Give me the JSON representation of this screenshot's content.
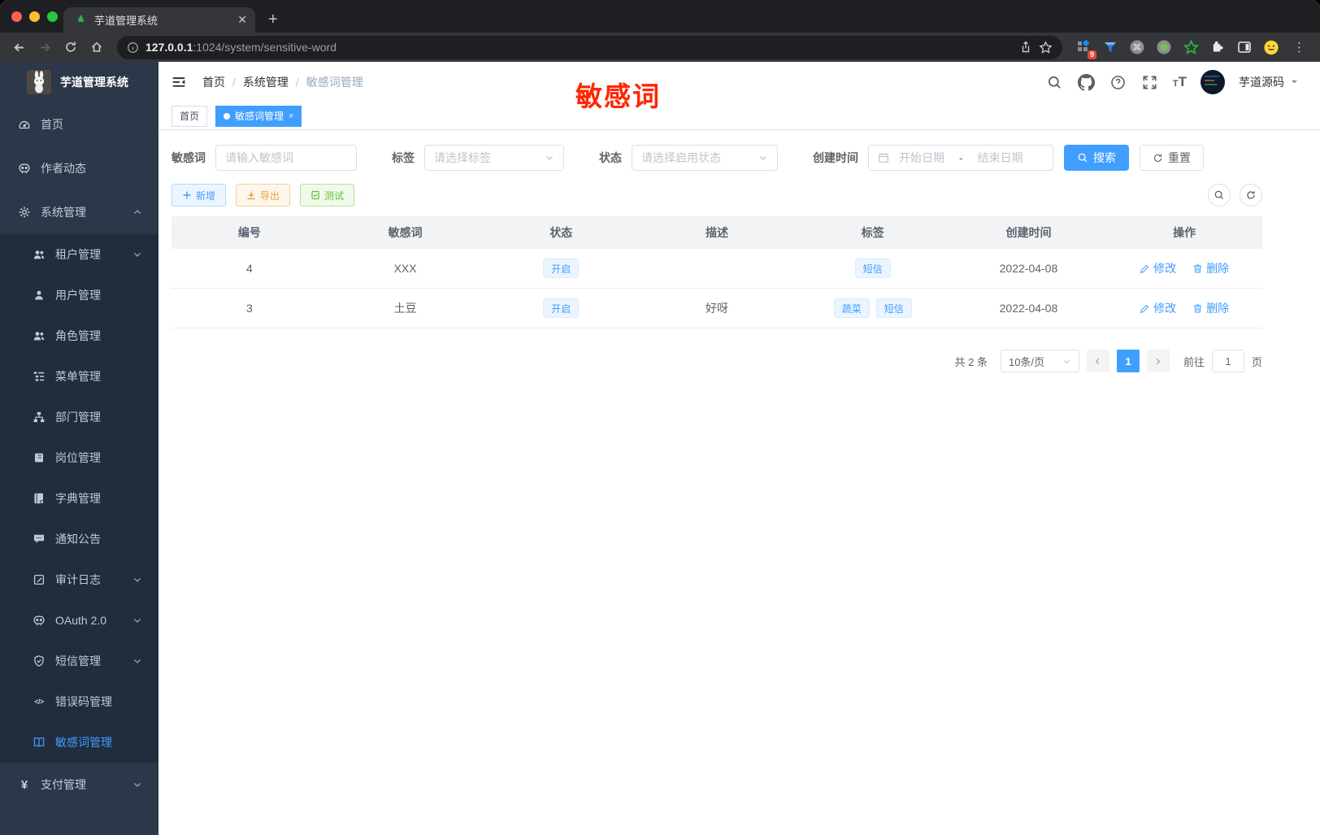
{
  "colors": {
    "primary": "#409eff",
    "warning": "#e6a23c",
    "success": "#67c23a",
    "annotation": "#ff2600",
    "sidebar_bg": "#2c3849",
    "submenu_bg": "#212c3c",
    "sidebar_text": "#bfcbd9",
    "tag_bg": "#ecf5ff",
    "tag_border": "#d9ecff",
    "thead_bg": "#f2f3f5"
  },
  "browser": {
    "tab_title": "芋道管理系统",
    "url_host": "127.0.0.1",
    "url_path": ":1024/system/sensitive-word",
    "extension_badge": "9"
  },
  "sidebar": {
    "logo_title": "芋道管理系统",
    "items": [
      {
        "label": "首页",
        "icon": "dashboard-icon",
        "level": "top"
      },
      {
        "label": "作者动态",
        "icon": "author-chat-icon",
        "level": "top"
      },
      {
        "label": "系统管理",
        "icon": "gear-icon",
        "level": "top",
        "chevron": "up"
      },
      {
        "label": "租户管理",
        "icon": "tenants-icon",
        "level": "sub",
        "chevron": "down"
      },
      {
        "label": "用户管理",
        "icon": "user-icon",
        "level": "sub"
      },
      {
        "label": "角色管理",
        "icon": "roles-icon",
        "level": "sub"
      },
      {
        "label": "菜单管理",
        "icon": "menu-tree-icon",
        "level": "sub"
      },
      {
        "label": "部门管理",
        "icon": "org-icon",
        "level": "sub"
      },
      {
        "label": "岗位管理",
        "icon": "post-icon",
        "level": "sub"
      },
      {
        "label": "字典管理",
        "icon": "dict-icon",
        "level": "sub"
      },
      {
        "label": "通知公告",
        "icon": "notice-icon",
        "level": "sub"
      },
      {
        "label": "审计日志",
        "icon": "audit-log-icon",
        "level": "sub",
        "chevron": "down"
      },
      {
        "label": "OAuth 2.0",
        "icon": "oauth-icon",
        "level": "sub",
        "chevron": "down"
      },
      {
        "label": "短信管理",
        "icon": "shield-icon",
        "level": "sub",
        "chevron": "down"
      },
      {
        "label": "错误码管理",
        "icon": "code-icon",
        "level": "sub"
      },
      {
        "label": "敏感词管理",
        "icon": "book-icon",
        "level": "sub",
        "active": true
      },
      {
        "label": "支付管理",
        "icon": "yen-icon",
        "level": "top",
        "chevron": "down"
      }
    ]
  },
  "header": {
    "breadcrumb": [
      "首页",
      "系统管理",
      "敏感词管理"
    ],
    "annotation": "敏感词",
    "username": "芋道源码"
  },
  "tabsbar": {
    "tabs": [
      {
        "label": "首页",
        "active": false
      },
      {
        "label": "敏感词管理",
        "active": true
      }
    ]
  },
  "filters": {
    "keyword_label": "敏感词",
    "keyword_placeholder": "请输入敏感词",
    "tag_label": "标签",
    "tag_placeholder": "请选择标签",
    "status_label": "状态",
    "status_placeholder": "请选择启用状态",
    "date_label": "创建时间",
    "date_start_placeholder": "开始日期",
    "date_separator": "-",
    "date_end_placeholder": "结束日期",
    "search_label": "搜索",
    "reset_label": "重置"
  },
  "actions": {
    "add_label": "新增",
    "export_label": "导出",
    "test_label": "测试"
  },
  "table": {
    "columns": [
      "编号",
      "敏感词",
      "状态",
      "描述",
      "标签",
      "创建时间",
      "操作"
    ],
    "rows": [
      {
        "id": "4",
        "word": "XXX",
        "status": "开启",
        "desc": "",
        "tags": [
          "短信"
        ],
        "created": "2022-04-08"
      },
      {
        "id": "3",
        "word": "土豆",
        "status": "开启",
        "desc": "好呀",
        "tags": [
          "蔬菜",
          "短信"
        ],
        "created": "2022-04-08"
      }
    ],
    "edit_label": "修改",
    "delete_label": "删除"
  },
  "pagination": {
    "total_text": "共 2 条",
    "page_size_text": "10条/页",
    "current_page": "1",
    "goto_label": "前往",
    "goto_value": "1",
    "page_unit": "页"
  }
}
